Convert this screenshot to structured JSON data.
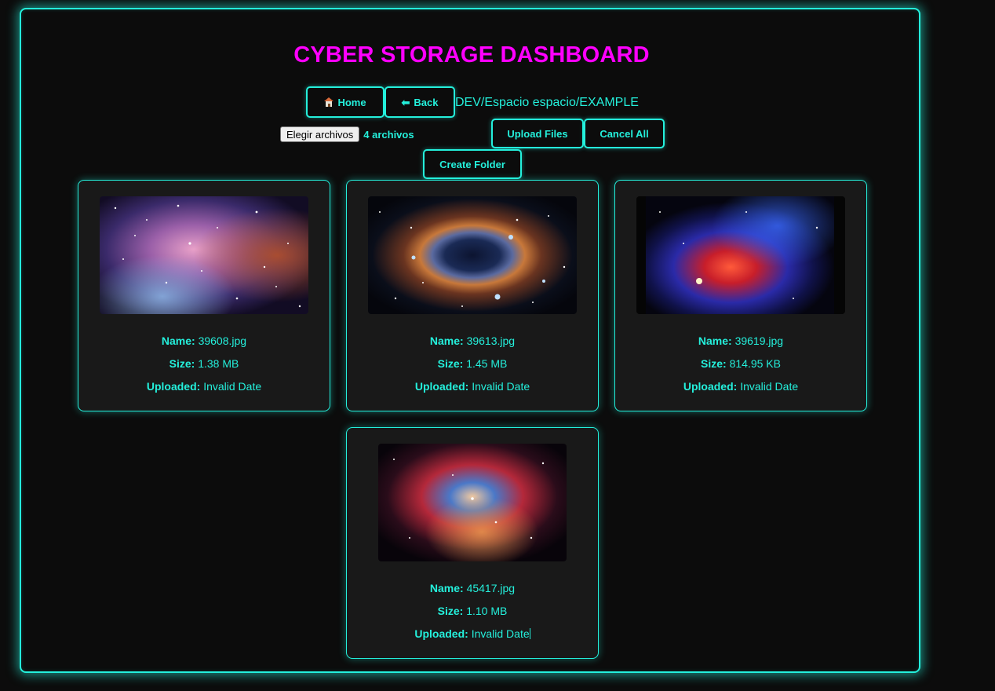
{
  "page": {
    "title": "CYBER STORAGE DASHBOARD",
    "accent_color": "#24f0dc",
    "title_color": "#ff00ff"
  },
  "nav": {
    "home_label": "Home",
    "home_icon": "house-emoji-icon",
    "back_label": "Back",
    "back_icon": "arrow-left-icon",
    "path": "DEV/Espacio espacio/EXAMPLE"
  },
  "upload": {
    "choose_button_label": "Elegir archivos",
    "file_count": "4 archivos",
    "upload_label": "Upload Files",
    "cancel_label": "Cancel All",
    "create_folder_label": "Create Folder"
  },
  "labels": {
    "name": "Name:",
    "size": "Size:",
    "uploaded": "Uploaded:"
  },
  "files": [
    {
      "name": "39608.jpg",
      "size": "1.38 MB",
      "uploaded": "Invalid Date"
    },
    {
      "name": "39613.jpg",
      "size": "1.45 MB",
      "uploaded": "Invalid Date"
    },
    {
      "name": "39619.jpg",
      "size": "814.95 KB",
      "uploaded": "Invalid Date"
    },
    {
      "name": "45417.jpg",
      "size": "1.10 MB",
      "uploaded": "Invalid Date"
    }
  ]
}
